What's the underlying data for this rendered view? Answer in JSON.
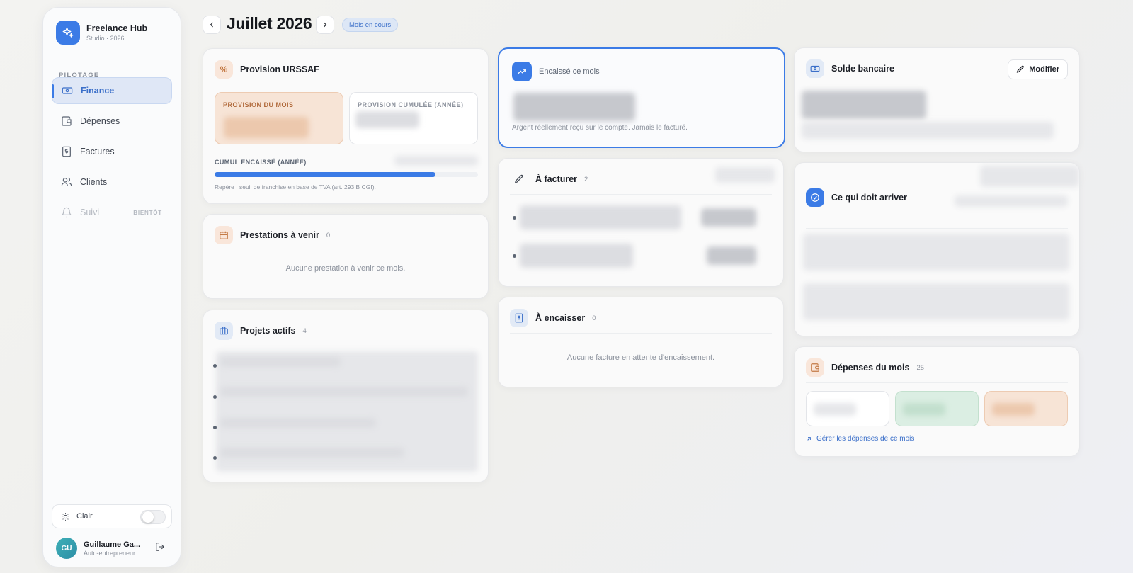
{
  "brand": {
    "name": "Freelance Hub",
    "subtitle": "Studio · 2026"
  },
  "sidebar": {
    "section_label": "PILOTAGE",
    "items": [
      {
        "label": "Finance",
        "icon": "banknote-icon",
        "active": true
      },
      {
        "label": "Dépenses",
        "icon": "wallet-icon"
      },
      {
        "label": "Factures",
        "icon": "invoice-icon"
      },
      {
        "label": "Clients",
        "icon": "users-icon"
      },
      {
        "label": "Suivi",
        "icon": "bell-icon",
        "disabled": true,
        "badge": "BIENTÔT"
      }
    ],
    "theme": {
      "label": "Clair",
      "enabled": false
    },
    "user": {
      "initials": "GU",
      "name": "Guillaume Ga...",
      "role": "Auto-entrepreneur"
    }
  },
  "header": {
    "title": "Juillet 2026",
    "badge": "Mois en cours"
  },
  "urssaf": {
    "title": "Provision URSSAF",
    "icon_glyph": "%",
    "provision_mois_label": "PROVISION DU MOIS",
    "provision_cumulee_label": "PROVISION CUMULÉE (ANNÉE)",
    "cumul_label": "CUMUL ENCAISSÉ (ANNÉE)",
    "progress": 0.84,
    "note": "Repère : seuil de franchise en base de TVA (art. 293 B CGI)."
  },
  "prestations": {
    "title": "Prestations à venir",
    "count": "0",
    "empty": "Aucune prestation à venir ce mois."
  },
  "projets": {
    "title": "Projets actifs",
    "count": "4"
  },
  "encaisse": {
    "title": "Encaissé ce mois",
    "note": "Argent réellement reçu sur le compte. Jamais le facturé."
  },
  "a_facturer": {
    "title": "À facturer",
    "count": "2"
  },
  "a_encaisser": {
    "title": "À encaisser",
    "count": "0",
    "empty": "Aucune facture en attente d'encaissement."
  },
  "solde": {
    "title": "Solde bancaire",
    "button": "Modifier"
  },
  "arriver": {
    "title": "Ce qui doit arriver"
  },
  "depenses": {
    "title": "Dépenses du mois",
    "count": "25",
    "link": "Gérer les dépenses de ce mois"
  },
  "colors": {
    "accent": "#3b7be6",
    "peach": "#f7e4d6",
    "green": "#dbeee3"
  }
}
